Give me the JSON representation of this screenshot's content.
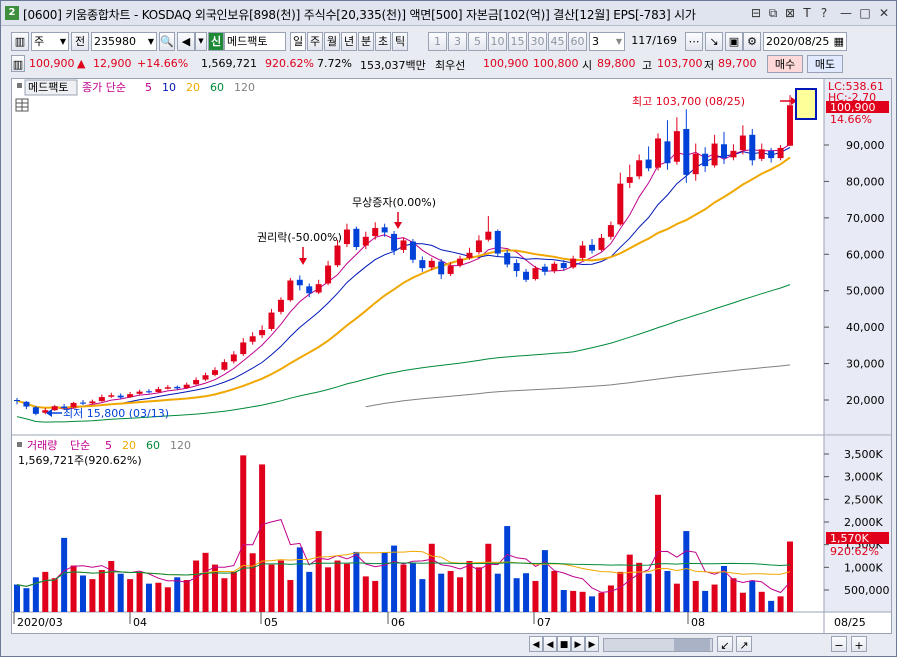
{
  "window": {
    "number": "2",
    "title": "[0600] 키움종합차트 - KOSDAQ 외국인보유[898(천)] 주식수[20,335(천)] 액면[500] 자본금[102(억)] 결산[12월] EPS[-783] 시가"
  },
  "toolbar": {
    "period_select": "주",
    "prev_label": "전",
    "code": "235980",
    "stock_name": "메드팩토",
    "shin_label": "신",
    "period_buttons": [
      "일",
      "주",
      "월",
      "년",
      "분",
      "초",
      "틱"
    ],
    "number_buttons": [
      "1",
      "3",
      "5",
      "10",
      "15",
      "30",
      "45",
      "60"
    ],
    "custom_value": "3",
    "page_counter": "117/169",
    "date": "2020/08/25"
  },
  "quote": {
    "price": "100,900",
    "change_arrow": "▲",
    "change": "12,900",
    "change_pct": "+14.66%",
    "volume": "1,569,721",
    "volume_ratio": "920.62%",
    "turnover": "7.72%",
    "trade_value": "153,037백만",
    "best_bid_label": "최우선",
    "best_ask": "100,900",
    "best_bid": "100,800",
    "open_label": "시",
    "open": "89,800",
    "high_label": "고",
    "high": "103,700",
    "low_label": "저",
    "low": "89,700",
    "buy_label": "매수",
    "sell_label": "매도"
  },
  "price_panel": {
    "legend_name": "메드팩토",
    "legend_ma_label": "종가 단순",
    "legend_ma_periods": [
      "5",
      "10",
      "20",
      "60",
      "120"
    ],
    "ma_colors": [
      "#c0008c",
      "#0018b8",
      "#f0a800",
      "#008a3a",
      "#808080"
    ],
    "annotations": {
      "high": "최고 103,700 (08/25)",
      "low": "최저 15,800 (03/13)",
      "rights_ex": "권리락(-50.00%)",
      "bonus_issue": "무상증자(0.00%)"
    },
    "right_labels": {
      "lc": "LC:538.61",
      "hc": "HC:-2.70",
      "price": "100,900",
      "pct": "14.66%"
    },
    "y_ticks": [
      "90,000",
      "80,000",
      "70,000",
      "60,000",
      "50,000",
      "40,000",
      "30,000",
      "20,000"
    ]
  },
  "volume_panel": {
    "legend_name": "거래량",
    "legend_ma_label": "단순",
    "legend_ma_periods": [
      "5",
      "20",
      "60",
      "120"
    ],
    "current": "1,569,721주(920.62%)",
    "right_labels": {
      "value": "1,570K",
      "pct": "920.62%"
    },
    "y_ticks": [
      "3,500K",
      "3,000K",
      "2,500K",
      "2,000K",
      "1,500K",
      "1,000K",
      "500,000"
    ]
  },
  "x_axis": {
    "labels": [
      "2020/03",
      "04",
      "05",
      "06",
      "07",
      "08"
    ],
    "right_date": "08/25"
  },
  "colors": {
    "up": "#e0001b",
    "down": "#0041d8",
    "frame": "#9aa3b5"
  }
}
